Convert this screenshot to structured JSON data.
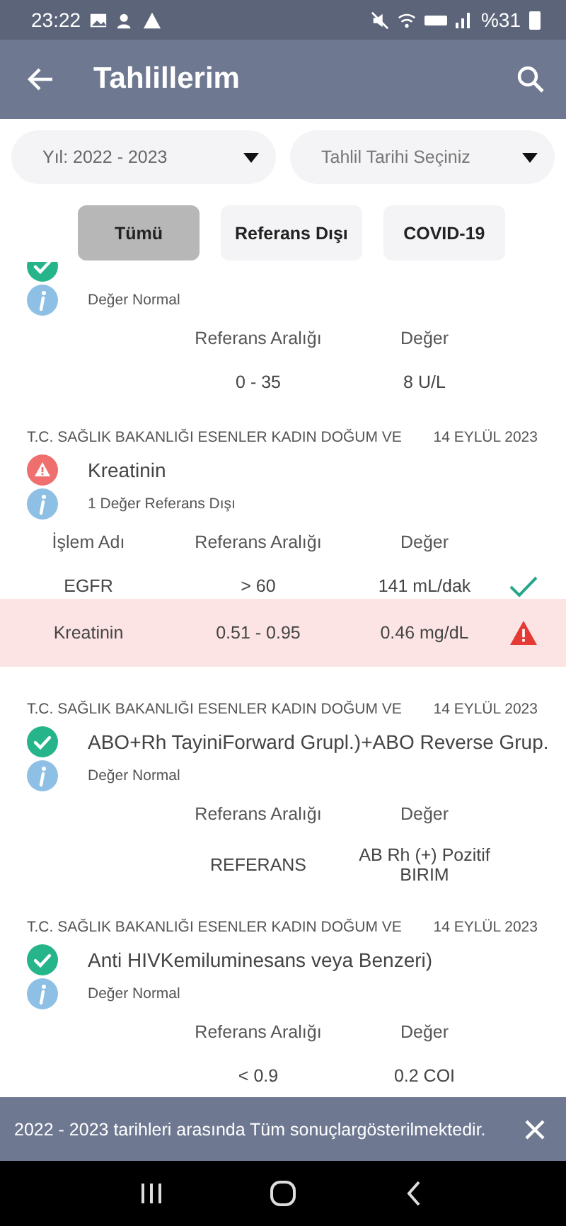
{
  "status_bar": {
    "time": "23:22",
    "battery": "%31"
  },
  "app_bar": {
    "title": "Tahlillerim"
  },
  "filters": [
    {
      "kind": "value",
      "text": "Yıl: 2022 - 2023"
    },
    {
      "kind": "placeholder",
      "text": "Tahlil Tarihi Seçiniz"
    }
  ],
  "chips": [
    {
      "label": "Tümü",
      "selected": true
    },
    {
      "label": "Referans Dışı",
      "selected": false
    },
    {
      "label": "COVID-19",
      "selected": false
    }
  ],
  "results": [
    {
      "normal": true,
      "summary": "Değer Normal",
      "columns": [
        "",
        "Referans Aralığı",
        "Değer"
      ],
      "rows": [
        {
          "cells": [
            "",
            "0 - 35",
            "8 U/L"
          ]
        }
      ]
    },
    {
      "hospital": "T.C. SAĞLIK BAKANLIĞI ESENLER KADIN DOĞUM VE",
      "date": "14 EYLÜL 2023",
      "normal": false,
      "title": "Kreatinin",
      "summary": "1 Değer Referans Dışı",
      "columns": [
        "İşlem Adı",
        "Referans Aralığı",
        "Değer"
      ],
      "rows": [
        {
          "cells": [
            "EGFR",
            "> 60",
            "141 mL/dak"
          ],
          "normal": true
        },
        {
          "cells": [
            "Kreatinin",
            "0.51 - 0.95",
            "0.46 mg/dL"
          ],
          "normal": false
        }
      ]
    },
    {
      "hospital": "T.C. SAĞLIK BAKANLIĞI ESENLER KADIN DOĞUM VE",
      "date": "14 EYLÜL 2023",
      "normal": true,
      "title": "ABO+Rh TayiniForward Grupl.)+ABO Reverse Grup.",
      "summary": "Değer Normal",
      "columns": [
        "",
        "Referans Aralığı",
        "Değer"
      ],
      "rows": [
        {
          "cells": [
            "",
            "REFERANS",
            "AB Rh (+) Pozitif\nBIRIM"
          ]
        }
      ]
    },
    {
      "hospital": "T.C. SAĞLIK BAKANLIĞI ESENLER KADIN DOĞUM VE",
      "date": "14 EYLÜL 2023",
      "normal": true,
      "title": "Anti HIVKemiluminesans veya Benzeri)",
      "summary": "Değer Normal",
      "columns": [
        "",
        "Referans Aralığı",
        "Değer"
      ],
      "rows": [
        {
          "cells": [
            "",
            "< 0.9",
            "0.2 COI"
          ]
        }
      ]
    }
  ],
  "snackbar": {
    "message": "2022 - 2023 tarihleri arasında Tüm sonuçlargösterilmektedir."
  }
}
